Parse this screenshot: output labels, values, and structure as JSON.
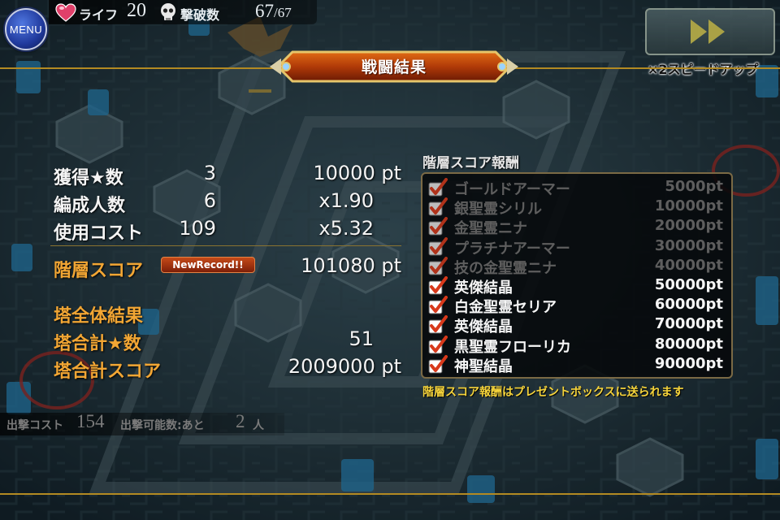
{
  "hud": {
    "menu_label": "MENU",
    "life_label": "ライフ",
    "life_value": "20",
    "kills_label": "撃破数",
    "kills_value": "67",
    "kills_total": "/67",
    "speed_label": "×2スピードアップ"
  },
  "banner": {
    "title": "戦闘結果"
  },
  "results": {
    "stars_label": "獲得★数",
    "stars_value": "3",
    "stars_points": "10000 pt",
    "members_label": "編成人数",
    "members_value": "6",
    "members_multiplier": "x1.90",
    "cost_label": "使用コスト",
    "cost_value": "109",
    "cost_multiplier": "x5.32",
    "floor_score_label": "階層スコア",
    "new_record_badge": "NewRecord!!",
    "floor_score_value": "101080 pt",
    "tower_header": "塔全体結果",
    "tower_stars_label": "塔合計★数",
    "tower_stars_value": "51",
    "tower_score_label": "塔合計スコア",
    "tower_score_value": "2009000 pt"
  },
  "rewards": {
    "title": "階層スコア報酬",
    "items": [
      {
        "name": "ゴールドアーマー",
        "points": "5000pt",
        "achieved": false
      },
      {
        "name": "銀聖霊シリル",
        "points": "10000pt",
        "achieved": false
      },
      {
        "name": "金聖霊ニナ",
        "points": "20000pt",
        "achieved": false
      },
      {
        "name": "プラチナアーマー",
        "points": "30000pt",
        "achieved": false
      },
      {
        "name": "技の金聖霊ニナ",
        "points": "40000pt",
        "achieved": false
      },
      {
        "name": "英傑結晶",
        "points": "50000pt",
        "achieved": true
      },
      {
        "name": "白金聖霊セリア",
        "points": "60000pt",
        "achieved": true
      },
      {
        "name": "英傑結晶",
        "points": "70000pt",
        "achieved": true
      },
      {
        "name": "黒聖霊フローリカ",
        "points": "80000pt",
        "achieved": true
      },
      {
        "name": "神聖結晶",
        "points": "90000pt",
        "achieved": true
      }
    ],
    "note": "階層スコア報酬はプレゼントボックスに送られます"
  },
  "status": {
    "sortie_cost_label": "出撃コスト",
    "sortie_cost_value": "154",
    "deployable_label": "出撃可能数:あと",
    "deployable_value": "2",
    "deployable_unit": "人"
  },
  "colors": {
    "accent_orange": "#f2a634",
    "note_yellow": "#f6d43b",
    "check_red": "#d8391b",
    "gold_line": "#b38a22"
  }
}
